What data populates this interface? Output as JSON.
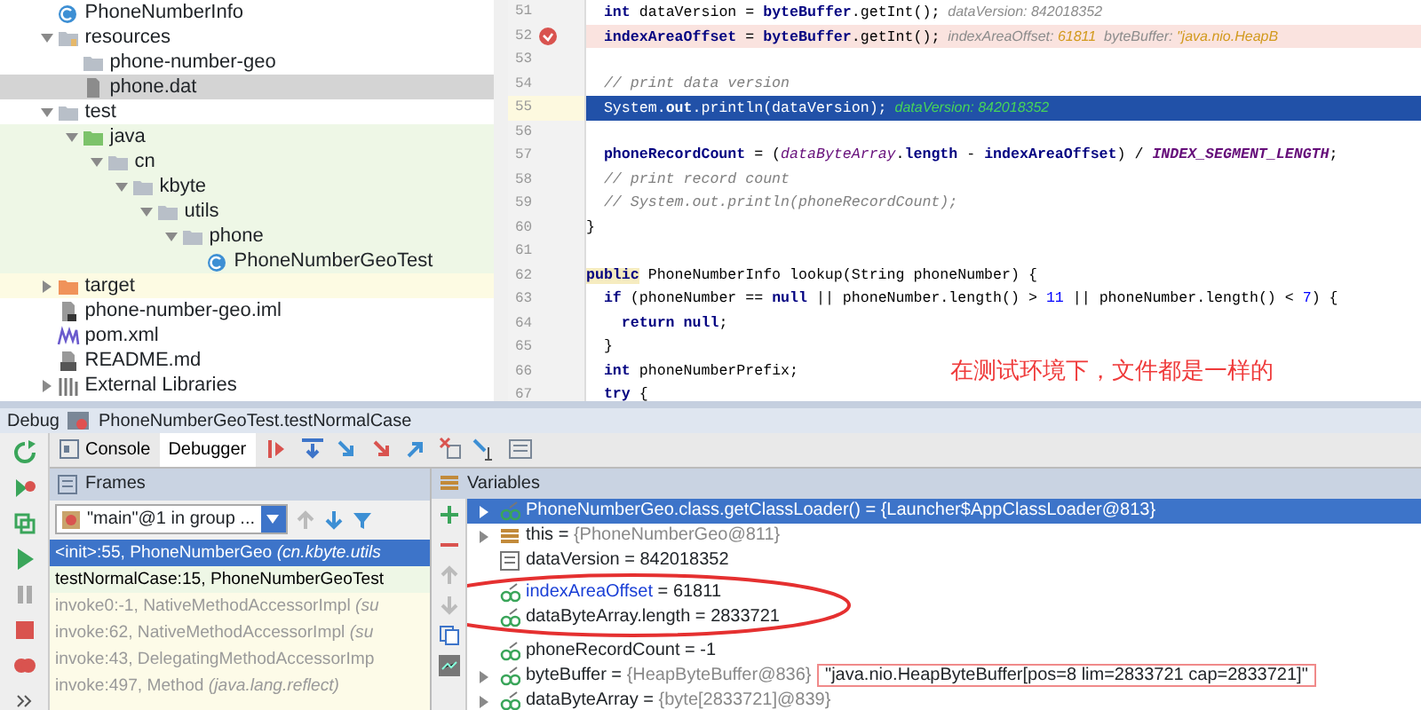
{
  "project_tree": [
    {
      "label": "PhoneNumberInfo",
      "kind": "class",
      "selected": false
    },
    {
      "label": "resources",
      "kind": "resource-folder",
      "expanded": true,
      "selected": false,
      "children": [
        {
          "label": "phone-number-geo",
          "kind": "folder",
          "selected": false
        },
        {
          "label": "phone.dat",
          "kind": "file",
          "selected": true
        }
      ]
    },
    {
      "label": "test",
      "kind": "folder",
      "expanded": true,
      "selected": false,
      "children": [
        {
          "label": "java",
          "kind": "test-folder",
          "test_root": true,
          "expanded": true,
          "selected": false,
          "children": [
            {
              "label": "cn",
              "kind": "folder",
              "expanded": true,
              "selected": false,
              "children": [
                {
                  "label": "kbyte",
                  "kind": "folder",
                  "expanded": true,
                  "selected": false,
                  "children": [
                    {
                      "label": "utils",
                      "kind": "folder",
                      "expanded": true,
                      "selected": false,
                      "children": [
                        {
                          "label": "phone",
                          "kind": "folder",
                          "expanded": true,
                          "selected": false,
                          "children": [
                            {
                              "label": "PhoneNumberGeoTest",
                              "kind": "class",
                              "selected": false
                            }
                          ]
                        }
                      ]
                    }
                  ]
                }
              ]
            }
          ]
        }
      ]
    },
    {
      "label": "target",
      "kind": "excluded-folder",
      "excluded": true,
      "expandable": true,
      "expanded": false,
      "selected": false
    },
    {
      "label": "phone-number-geo.iml",
      "kind": "iml",
      "selected": false
    },
    {
      "label": "pom.xml",
      "kind": "maven",
      "selected": false
    },
    {
      "label": "README.md",
      "kind": "md",
      "selected": false
    },
    {
      "label": "External Libraries",
      "kind": "library",
      "expandable": true,
      "expanded": false,
      "selected": false
    }
  ],
  "editor": {
    "lines": [
      {
        "number": "51",
        "breakpoint": false,
        "current": false,
        "segments": [
          {
            "kind": "bold",
            "text": "  int"
          },
          {
            "kind": "plain",
            "text": " dataVersion = "
          },
          {
            "kind": "bold",
            "text": "byteBuffer"
          },
          {
            "kind": "plain",
            "text": ".getInt();"
          },
          {
            "kind": "hint",
            "text": "  dataVersion: 842018352"
          }
        ]
      },
      {
        "number": "52",
        "breakpoint": true,
        "current": false,
        "segments": [
          {
            "kind": "bold",
            "text": "  indexAreaOffset"
          },
          {
            "kind": "plain",
            "text": " = "
          },
          {
            "kind": "bold",
            "text": "byteBuffer"
          },
          {
            "kind": "plain",
            "text": ".getInt();"
          },
          {
            "kind": "hint",
            "text": "  indexAreaOffset: "
          },
          {
            "kind": "hint_value",
            "text": "61811"
          },
          {
            "kind": "hint",
            "text": "  byteBuffer: "
          },
          {
            "kind": "hint_value",
            "text": "\"java.nio.HeapB"
          }
        ]
      },
      {
        "number": "53",
        "breakpoint": false,
        "current": false
      },
      {
        "number": "54",
        "breakpoint": false,
        "current": false,
        "segments": [
          {
            "kind": "comment",
            "text": "  // print data version"
          }
        ]
      },
      {
        "number": "55",
        "breakpoint": false,
        "current": true,
        "segments": [
          {
            "kind": "plain",
            "text": "  System."
          },
          {
            "kind": "bold",
            "text": "out"
          },
          {
            "kind": "plain",
            "text": ".println(dataVersion);"
          },
          {
            "kind": "hint",
            "text": "  dataVersion: 842018352"
          }
        ]
      },
      {
        "number": "56",
        "breakpoint": false,
        "current": false
      },
      {
        "number": "57",
        "breakpoint": false,
        "current": false,
        "segments": [
          {
            "kind": "bold",
            "text": "  phoneRecordCount"
          },
          {
            "kind": "plain",
            "text": " = ("
          },
          {
            "kind": "italic",
            "text": "dataByteArray"
          },
          {
            "kind": "plain",
            "text": "."
          },
          {
            "kind": "bold",
            "text": "length"
          },
          {
            "kind": "plain",
            "text": " - "
          },
          {
            "kind": "bold",
            "text": "indexAreaOffset"
          },
          {
            "kind": "plain",
            "text": ") / "
          },
          {
            "kind": "constant",
            "text": "INDEX_SEGMENT_LENGTH"
          },
          {
            "kind": "plain",
            "text": ";"
          }
        ]
      },
      {
        "number": "58",
        "breakpoint": false,
        "current": false,
        "segments": [
          {
            "kind": "comment",
            "text": "  // print record count"
          }
        ]
      },
      {
        "number": "59",
        "breakpoint": false,
        "current": false,
        "segments": [
          {
            "kind": "comment",
            "text": "  // System.out.println(phoneRecordCount);"
          }
        ]
      },
      {
        "number": "60",
        "breakpoint": false,
        "current": false,
        "segments": [
          {
            "kind": "plain",
            "text": "}"
          }
        ]
      },
      {
        "number": "61",
        "breakpoint": false,
        "current": false
      },
      {
        "number": "62",
        "breakpoint": false,
        "current": false,
        "segments": [
          {
            "kind": "keyword_marked",
            "text": "public"
          },
          {
            "kind": "plain",
            "text": " PhoneNumberInfo lookup(String phoneNumber) {"
          }
        ]
      },
      {
        "number": "63",
        "breakpoint": false,
        "current": false,
        "segments": [
          {
            "kind": "bold",
            "text": "  if"
          },
          {
            "kind": "plain",
            "text": " (phoneNumber == "
          },
          {
            "kind": "bold",
            "text": "null"
          },
          {
            "kind": "plain",
            "text": " || phoneNumber.length() > "
          },
          {
            "kind": "number",
            "text": "11"
          },
          {
            "kind": "plain",
            "text": " || phoneNumber.length() < "
          },
          {
            "kind": "number",
            "text": "7"
          },
          {
            "kind": "plain",
            "text": ") {"
          }
        ]
      },
      {
        "number": "64",
        "breakpoint": false,
        "current": false,
        "segments": [
          {
            "kind": "bold",
            "text": "    return null"
          },
          {
            "kind": "plain",
            "text": ";"
          }
        ]
      },
      {
        "number": "65",
        "breakpoint": false,
        "current": false,
        "segments": [
          {
            "kind": "plain",
            "text": "  }"
          }
        ]
      },
      {
        "number": "66",
        "breakpoint": false,
        "current": false,
        "segments": [
          {
            "kind": "bold",
            "text": "  int"
          },
          {
            "kind": "plain",
            "text": " phoneNumberPrefix;"
          }
        ]
      },
      {
        "number": "67",
        "breakpoint": false,
        "current": false,
        "segments": [
          {
            "kind": "bold",
            "text": "  try"
          },
          {
            "kind": "plain",
            "text": " {"
          }
        ]
      }
    ],
    "annotation": "在测试环境下，文件都是一样的"
  },
  "debug": {
    "title": "Debug",
    "config": "PhoneNumberGeoTest.testNormalCase",
    "tabs": [
      {
        "label": "Console",
        "selected": false
      },
      {
        "label": "Debugger",
        "selected": true
      }
    ],
    "frames": {
      "title": "Frames",
      "thread": "\"main\"@1 in group ...",
      "items": [
        {
          "location": "<init>:55, PhoneNumberGeo",
          "package": "(cn.kbyte.utils",
          "kind": "user",
          "selected": true
        },
        {
          "location": "testNormalCase:15, PhoneNumberGeoTest",
          "kind": "user",
          "selected": false
        },
        {
          "location": "invoke0:-1, NativeMethodAccessorImpl",
          "package": "(su",
          "kind": "library",
          "selected": false
        },
        {
          "location": "invoke:62, NativeMethodAccessorImpl",
          "package": "(su",
          "kind": "library",
          "selected": false
        },
        {
          "location": "invoke:43, DelegatingMethodAccessorImp",
          "kind": "library",
          "selected": false
        },
        {
          "location": "invoke:497, Method",
          "package": "(java.lang.reflect)",
          "kind": "library",
          "selected": false
        }
      ]
    },
    "variables": {
      "title": "Variables",
      "items": [
        {
          "kind": "watch",
          "name": "PhoneNumberGeo.class.getClassLoader()",
          "operator": "=",
          "type": "{Launcher$AppClassLoader@813}",
          "expandable": true,
          "selected": true,
          "changed": false,
          "circled": false,
          "boxed": false
        },
        {
          "kind": "field",
          "name": "this",
          "operator": "=",
          "type": "{PhoneNumberGeo@811}",
          "expandable": true,
          "selected": false,
          "changed": false,
          "circled": false,
          "boxed": false
        },
        {
          "kind": "primitive",
          "name": "dataVersion",
          "operator": "=",
          "value": "842018352",
          "expandable": false,
          "selected": false,
          "changed": false,
          "circled": false,
          "boxed": false
        },
        {
          "kind": "watch",
          "name": "indexAreaOffset",
          "operator": "=",
          "value": "61811",
          "expandable": false,
          "selected": false,
          "changed": true,
          "circled": true,
          "boxed": false
        },
        {
          "kind": "watch",
          "name": "dataByteArray.length",
          "operator": "=",
          "value": "2833721",
          "expandable": false,
          "selected": false,
          "changed": false,
          "circled": true,
          "boxed": false
        },
        {
          "kind": "watch",
          "name": "phoneRecordCount",
          "operator": "=",
          "value": "-1",
          "expandable": false,
          "selected": false,
          "changed": false,
          "circled": false,
          "boxed": false
        },
        {
          "kind": "watch",
          "name": "byteBuffer",
          "operator": "=",
          "type": "{HeapByteBuffer@836}",
          "value": "\"java.nio.HeapByteBuffer[pos=8 lim=2833721 cap=2833721]\"",
          "expandable": true,
          "selected": false,
          "changed": false,
          "circled": false,
          "boxed": true
        },
        {
          "kind": "watch",
          "name": "dataByteArray",
          "operator": "=",
          "type": "{byte[2833721]@839}",
          "expandable": true,
          "selected": false,
          "changed": false,
          "circled": false,
          "boxed": false
        }
      ]
    }
  }
}
